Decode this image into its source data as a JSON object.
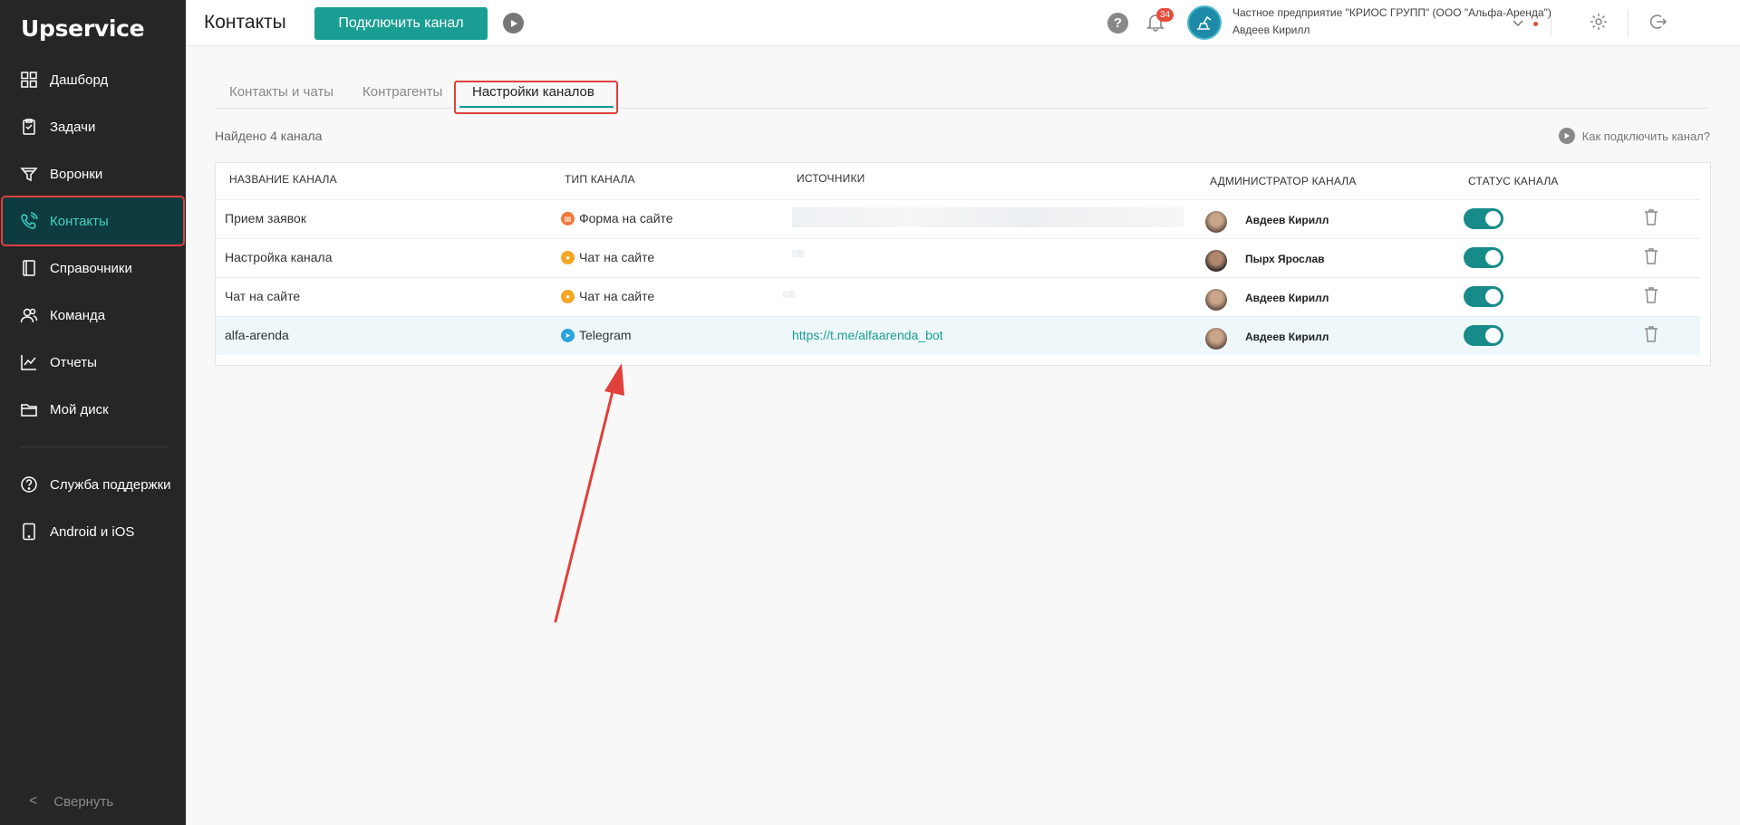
{
  "app": {
    "logo": "Upservice"
  },
  "sidebar": {
    "items": [
      {
        "label": "Дашборд",
        "icon": "dashboard-icon"
      },
      {
        "label": "Задачи",
        "icon": "tasks-icon"
      },
      {
        "label": "Воронки",
        "icon": "funnel-icon"
      },
      {
        "label": "Контакты",
        "icon": "contacts-icon",
        "active": true
      },
      {
        "label": "Справочники",
        "icon": "book-icon"
      },
      {
        "label": "Команда",
        "icon": "team-icon"
      },
      {
        "label": "Отчеты",
        "icon": "reports-icon"
      },
      {
        "label": "Мой диск",
        "icon": "folder-icon"
      }
    ],
    "bottom_items": [
      {
        "label": "Служба поддержки",
        "icon": "help-circle-icon"
      },
      {
        "label": "Android и iOS",
        "icon": "mobile-icon"
      }
    ],
    "collapse_label": "Свернуть"
  },
  "header": {
    "title": "Контакты",
    "connect_button": "Подключить канал",
    "help": "?",
    "notifications_count": "34",
    "company_name": "Частное предприятие \"КРИОС ГРУПП\" (ООО \"Альфа-Аренда\")",
    "user_name": "Авдеев Кирилл"
  },
  "tabs": [
    {
      "label": "Контакты и чаты"
    },
    {
      "label": "Контрагенты"
    },
    {
      "label": "Настройки каналов",
      "active": true
    }
  ],
  "found_text": "Найдено 4 канала",
  "how_to_link": "Как подключить канал?",
  "table": {
    "columns": [
      "Название канала",
      "Тип канала",
      "Источники",
      "Администратор канала",
      "Статус канала"
    ],
    "rows": [
      {
        "name": "Прием заявок",
        "type": "Форма на сайте",
        "type_icon": "form-icon",
        "type_color": "#f07a3a",
        "source": "",
        "admin": "Авдеев Кирилл",
        "status_on": true
      },
      {
        "name": "Настройка канала",
        "type": "Чат на сайте",
        "type_icon": "chat-icon",
        "type_color": "#f5a623",
        "source": "",
        "admin": "Пырх Ярослав",
        "status_on": true
      },
      {
        "name": "Чат на сайте",
        "type": "Чат на сайте",
        "type_icon": "chat-icon",
        "type_color": "#f5a623",
        "source": "",
        "admin": "Авдеев Кирилл",
        "status_on": true
      },
      {
        "name": "alfa-arenda",
        "type": "Telegram",
        "type_icon": "telegram-icon",
        "type_color": "#2aa3e0",
        "source": "https://t.me/alfaarenda_bot",
        "admin": "Авдеев Кирилл",
        "status_on": true
      }
    ]
  },
  "colors": {
    "accent": "#1a9e93",
    "sidebar_bg": "#262626",
    "annotation": "#e0413b"
  }
}
